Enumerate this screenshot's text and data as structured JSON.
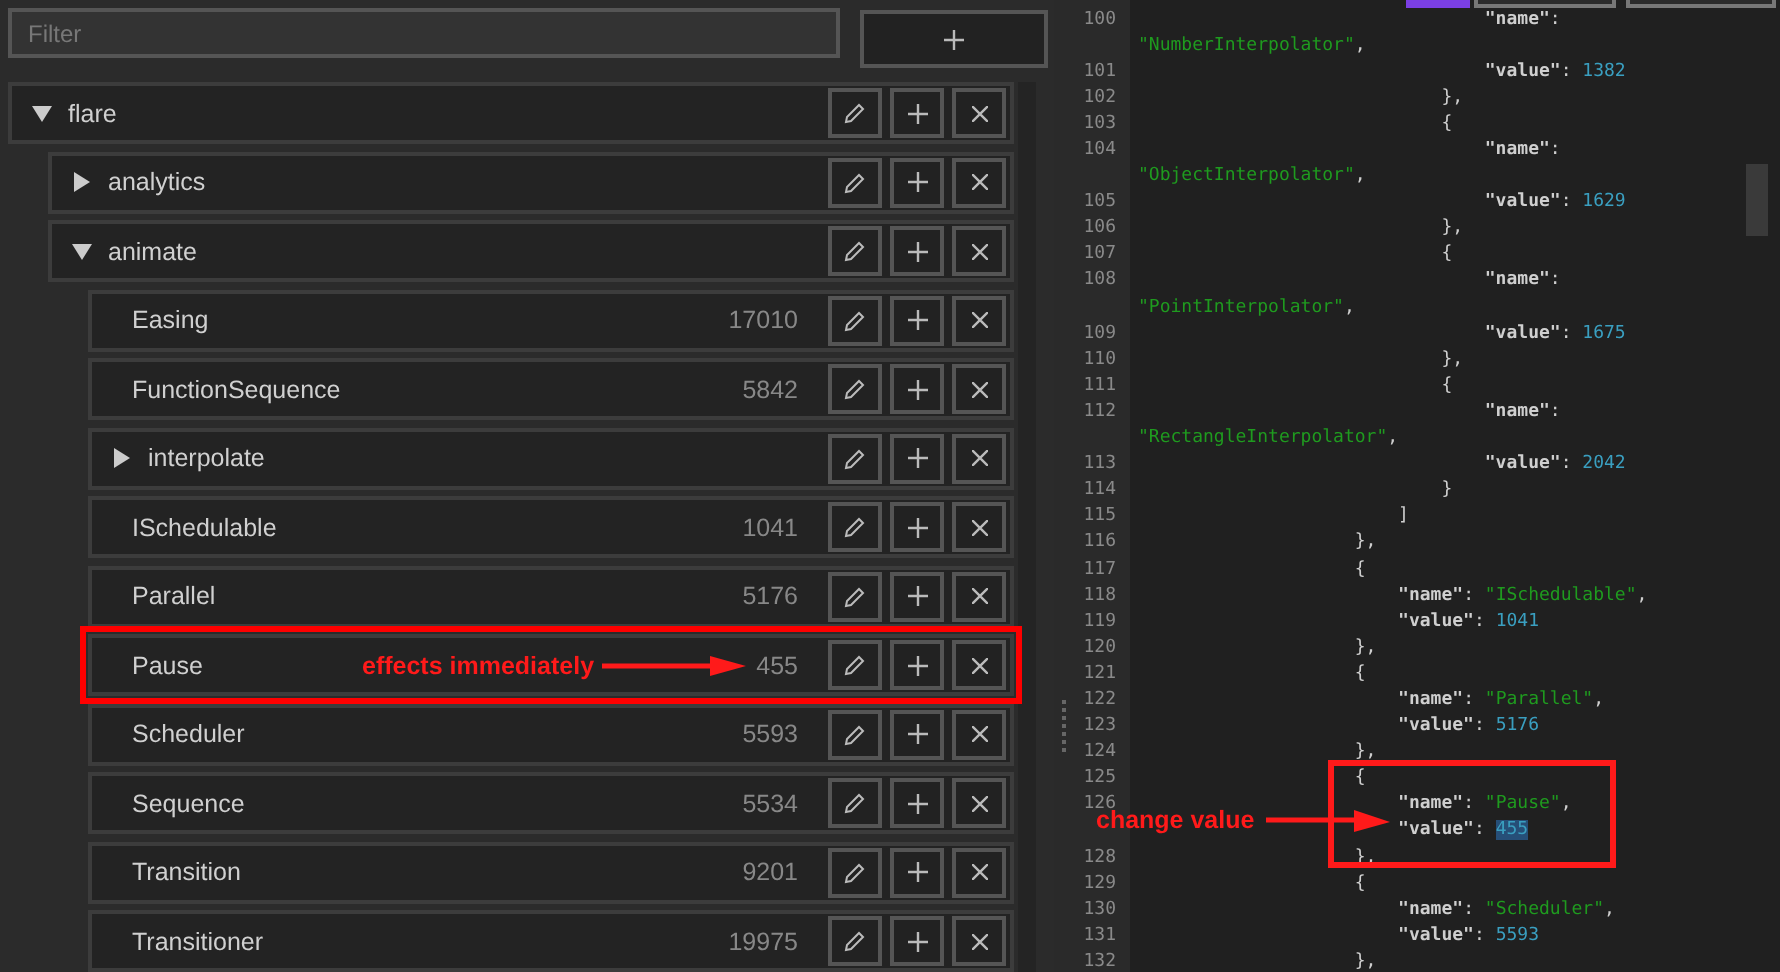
{
  "filter": {
    "placeholder": "Filter"
  },
  "tree": {
    "label": "flare",
    "expanded": true,
    "children": [
      {
        "label": "analytics",
        "expanded": false
      },
      {
        "label": "animate",
        "expanded": true,
        "children": [
          {
            "label": "Easing",
            "value": "17010"
          },
          {
            "label": "FunctionSequence",
            "value": "5842"
          },
          {
            "label": "interpolate",
            "expanded": false
          },
          {
            "label": "ISchedulable",
            "value": "1041"
          },
          {
            "label": "Parallel",
            "value": "5176"
          },
          {
            "label": "Pause",
            "value": "455",
            "highlighted": true,
            "annotation": "effects immediately"
          },
          {
            "label": "Scheduler",
            "value": "5593"
          },
          {
            "label": "Sequence",
            "value": "5534"
          },
          {
            "label": "Transition",
            "value": "9201"
          },
          {
            "label": "Transitioner",
            "value": "19975"
          }
        ]
      }
    ]
  },
  "editor_tabs": [
    {
      "selected": true
    },
    {
      "selected": false
    },
    {
      "selected": false
    }
  ],
  "editor": {
    "annotation": "change value",
    "lines": [
      {
        "number": "100",
        "tokens": [
          {
            "kind": "key",
            "text": "                                \"name\""
          },
          {
            "kind": "punct",
            "text": ":"
          }
        ]
      },
      {
        "tokens": [
          {
            "kind": "string",
            "text": "\"NumberInterpolator\""
          },
          {
            "kind": "punct",
            "text": ","
          }
        ]
      },
      {
        "number": "101",
        "tokens": [
          {
            "kind": "key",
            "text": "                                \"value\""
          },
          {
            "kind": "punct",
            "text": ": "
          },
          {
            "kind": "number",
            "text": "1382"
          }
        ]
      },
      {
        "number": "102",
        "tokens": [
          {
            "kind": "punct",
            "text": "                            },"
          }
        ]
      },
      {
        "number": "103",
        "tokens": [
          {
            "kind": "punct",
            "text": "                            {"
          }
        ]
      },
      {
        "number": "104",
        "tokens": [
          {
            "kind": "key",
            "text": "                                \"name\""
          },
          {
            "kind": "punct",
            "text": ":"
          }
        ]
      },
      {
        "tokens": [
          {
            "kind": "string",
            "text": "\"ObjectInterpolator\""
          },
          {
            "kind": "punct",
            "text": ","
          }
        ]
      },
      {
        "number": "105",
        "tokens": [
          {
            "kind": "key",
            "text": "                                \"value\""
          },
          {
            "kind": "punct",
            "text": ": "
          },
          {
            "kind": "number",
            "text": "1629"
          }
        ]
      },
      {
        "number": "106",
        "tokens": [
          {
            "kind": "punct",
            "text": "                            },"
          }
        ]
      },
      {
        "number": "107",
        "tokens": [
          {
            "kind": "punct",
            "text": "                            {"
          }
        ]
      },
      {
        "number": "108",
        "tokens": [
          {
            "kind": "key",
            "text": "                                \"name\""
          },
          {
            "kind": "punct",
            "text": ":"
          }
        ]
      },
      {
        "tokens": [
          {
            "kind": "string",
            "text": "\"PointInterpolator\""
          },
          {
            "kind": "punct",
            "text": ","
          }
        ]
      },
      {
        "number": "109",
        "tokens": [
          {
            "kind": "key",
            "text": "                                \"value\""
          },
          {
            "kind": "punct",
            "text": ": "
          },
          {
            "kind": "number",
            "text": "1675"
          }
        ]
      },
      {
        "number": "110",
        "tokens": [
          {
            "kind": "punct",
            "text": "                            },"
          }
        ]
      },
      {
        "number": "111",
        "tokens": [
          {
            "kind": "punct",
            "text": "                            {"
          }
        ]
      },
      {
        "number": "112",
        "tokens": [
          {
            "kind": "key",
            "text": "                                \"name\""
          },
          {
            "kind": "punct",
            "text": ":"
          }
        ]
      },
      {
        "tokens": [
          {
            "kind": "string",
            "text": "\"RectangleInterpolator\""
          },
          {
            "kind": "punct",
            "text": ","
          }
        ]
      },
      {
        "number": "113",
        "tokens": [
          {
            "kind": "key",
            "text": "                                \"value\""
          },
          {
            "kind": "punct",
            "text": ": "
          },
          {
            "kind": "number",
            "text": "2042"
          }
        ]
      },
      {
        "number": "114",
        "tokens": [
          {
            "kind": "punct",
            "text": "                            }"
          }
        ]
      },
      {
        "number": "115",
        "tokens": [
          {
            "kind": "punct",
            "text": "                        ]"
          }
        ]
      },
      {
        "number": "116",
        "tokens": [
          {
            "kind": "punct",
            "text": "                    },"
          }
        ]
      },
      {
        "number": "117",
        "tokens": [
          {
            "kind": "punct",
            "text": "                    {"
          }
        ]
      },
      {
        "number": "118",
        "tokens": [
          {
            "kind": "key",
            "text": "                        \"name\""
          },
          {
            "kind": "punct",
            "text": ": "
          },
          {
            "kind": "string",
            "text": "\"ISchedulable\""
          },
          {
            "kind": "punct",
            "text": ","
          }
        ]
      },
      {
        "number": "119",
        "tokens": [
          {
            "kind": "key",
            "text": "                        \"value\""
          },
          {
            "kind": "punct",
            "text": ": "
          },
          {
            "kind": "number",
            "text": "1041"
          }
        ]
      },
      {
        "number": "120",
        "tokens": [
          {
            "kind": "punct",
            "text": "                    },"
          }
        ]
      },
      {
        "number": "121",
        "tokens": [
          {
            "kind": "punct",
            "text": "                    {"
          }
        ]
      },
      {
        "number": "122",
        "tokens": [
          {
            "kind": "key",
            "text": "                        \"name\""
          },
          {
            "kind": "punct",
            "text": ": "
          },
          {
            "kind": "string",
            "text": "\"Parallel\""
          },
          {
            "kind": "punct",
            "text": ","
          }
        ]
      },
      {
        "number": "123",
        "tokens": [
          {
            "kind": "key",
            "text": "                        \"value\""
          },
          {
            "kind": "punct",
            "text": ": "
          },
          {
            "kind": "number",
            "text": "5176"
          }
        ]
      },
      {
        "number": "124",
        "tokens": [
          {
            "kind": "punct",
            "text": "                    },"
          }
        ]
      },
      {
        "number": "125",
        "tokens": [
          {
            "kind": "punct",
            "text": "                    {"
          }
        ]
      },
      {
        "number": "126",
        "tokens": [
          {
            "kind": "key",
            "text": "                        \"name\""
          },
          {
            "kind": "punct",
            "text": ": "
          },
          {
            "kind": "string",
            "text": "\"Pause\""
          },
          {
            "kind": "punct",
            "text": ","
          }
        ]
      },
      {
        "tokens": [
          {
            "kind": "key",
            "text": "                        \"value\""
          },
          {
            "kind": "punct",
            "text": ": "
          },
          {
            "kind": "number",
            "text": "455",
            "selected": true
          }
        ]
      },
      {
        "number": "128",
        "tokens": [
          {
            "kind": "punct",
            "text": "                    },"
          }
        ]
      },
      {
        "number": "129",
        "tokens": [
          {
            "kind": "punct",
            "text": "                    {"
          }
        ]
      },
      {
        "number": "130",
        "tokens": [
          {
            "kind": "key",
            "text": "                        \"name\""
          },
          {
            "kind": "punct",
            "text": ": "
          },
          {
            "kind": "string",
            "text": "\"Scheduler\""
          },
          {
            "kind": "punct",
            "text": ","
          }
        ]
      },
      {
        "number": "131",
        "tokens": [
          {
            "kind": "key",
            "text": "                        \"value\""
          },
          {
            "kind": "punct",
            "text": ": "
          },
          {
            "kind": "number",
            "text": "5593"
          }
        ]
      },
      {
        "number": "132",
        "tokens": [
          {
            "kind": "punct",
            "text": "                    },"
          }
        ]
      }
    ]
  }
}
